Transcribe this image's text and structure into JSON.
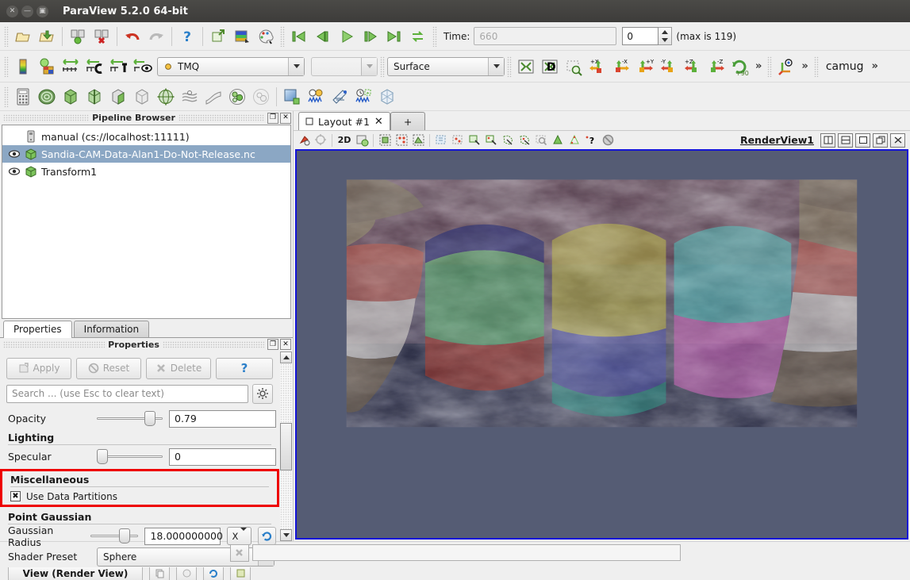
{
  "window": {
    "title": "ParaView 5.2.0 64-bit",
    "controls": [
      "close",
      "minimize",
      "maximize"
    ]
  },
  "main_toolbar": {
    "file_buttons": [
      "open-file-icon",
      "open-recent-icon",
      "connect-server-icon",
      "disconnect-server-icon"
    ],
    "edit_buttons": [
      "undo-icon",
      "redo-icon"
    ],
    "help_button": "help-icon",
    "camera_buttons": [
      "camera-undo-icon",
      "color-map-icon",
      "edit-color-map-icon"
    ]
  },
  "vcr": {
    "buttons": [
      "first-frame",
      "previous-frame",
      "play",
      "next-frame",
      "last-frame",
      "loop"
    ],
    "time_label": "Time:",
    "time_value": "660",
    "frame_value": "0",
    "max_label": "(max is 119)"
  },
  "active_variables": {
    "color_legend_icons": [
      "scalar-bar-icon",
      "rescale-custom-icon",
      "rescale-data-icon",
      "rescale-time-icon",
      "rescale-visible-icon",
      "rescale-visible-eye-icon"
    ],
    "array_name": "TMQ",
    "component": "",
    "representation": "Surface",
    "axis_buttons": [
      "+X",
      "-X",
      "+Y",
      "-Y",
      "+Z",
      "-Z"
    ],
    "rotate_label": "+90",
    "overflow": "»",
    "camera_widget": "camera-orientation-icon",
    "macro_label": "camug"
  },
  "filters_toolbar": {
    "items": [
      "calculator-icon",
      "contour-icon",
      "clip-icon",
      "slice-icon",
      "threshold-icon",
      "extract-subset-icon",
      "glyph-icon",
      "stream-tracer-icon",
      "warp-icon",
      "group-datasets-icon",
      "extract-level-icon",
      "plot-over-line-icon",
      "plot-data-icon",
      "plot-selection-icon",
      "plot-over-time-icon",
      "extract-block-icon"
    ]
  },
  "pipeline_browser": {
    "title": "Pipeline Browser",
    "dock_buttons": [
      "undock-icon",
      "close-icon"
    ],
    "items": [
      {
        "label": "manual (cs://localhost:11111)",
        "icon": "server-icon",
        "selected": false,
        "visible": null,
        "indent": 0
      },
      {
        "label": "Sandia-CAM-Data-Alan1-Do-Not-Release.nc",
        "icon": "dataset-icon",
        "selected": true,
        "visible": true,
        "indent": 0
      },
      {
        "label": "Transform1",
        "icon": "dataset-icon",
        "selected": false,
        "visible": true,
        "indent": 0
      }
    ]
  },
  "properties_panel": {
    "tabs": [
      {
        "label": "Properties",
        "active": true
      },
      {
        "label": "Information",
        "active": false
      }
    ],
    "dock_title": "Properties",
    "dock_buttons": [
      "undock-icon",
      "close-icon"
    ],
    "buttons": [
      {
        "label": "Apply",
        "enabled": false,
        "icon": "apply-icon"
      },
      {
        "label": "Reset",
        "enabled": false,
        "icon": "reset-icon"
      },
      {
        "label": "Delete",
        "enabled": false,
        "icon": "delete-icon"
      },
      {
        "label": "?",
        "enabled": true,
        "icon": "help-icon"
      }
    ],
    "search_placeholder": "Search ... (use Esc to clear text)",
    "gear_icon": "gear-icon",
    "rows": [
      {
        "type": "slider",
        "name": "Opacity",
        "value": "0.79",
        "fraction": 0.79
      },
      {
        "type": "section",
        "name": "Lighting"
      },
      {
        "type": "slider",
        "name": "Specular",
        "value": "0",
        "fraction": 0.02
      },
      {
        "type": "section",
        "name": "Miscellaneous",
        "highlight": true
      },
      {
        "type": "checkbox",
        "name": "Use Data Partitions",
        "checked": true,
        "highlight": true
      },
      {
        "type": "section",
        "name": "Point Gaussian"
      },
      {
        "type": "radius",
        "name": "Gaussian Radius",
        "value": "18.000000000",
        "axis": "X",
        "reset_icon": "reset-range-icon",
        "fraction": 0.62
      },
      {
        "type": "combo",
        "name": "Shader Preset",
        "value": "Sphere"
      }
    ],
    "partial_row_hint": "View (Render View)"
  },
  "layout": {
    "tabs": [
      {
        "label": "Layout #1",
        "closable": true
      },
      {
        "label": "+",
        "closable": false
      }
    ],
    "view_toolbar": [
      "interact-icon",
      "pick-center-icon",
      "2D",
      "reset-camera-icon",
      "select-cells-icon",
      "select-points-icon",
      "select-frustum-cells-icon",
      "select-block-icon",
      "select-points-through-icon",
      "hover-cells-icon",
      "hover-points-icon",
      "select-polygon-cells-icon",
      "select-polygon-points-icon",
      "zoom-box-icon",
      "plot-cells-icon",
      "plot-points-icon",
      "help-view-icon",
      "no-selection-icon"
    ],
    "mode_2d_label": "2D",
    "view_name": "RenderView1",
    "view_buttons": [
      "split-horizontal-icon",
      "split-vertical-icon",
      "maximize-icon",
      "undock-icon",
      "close-icon"
    ]
  },
  "render_view": {
    "background_color": "#555c74",
    "dataset_description": "Global equirectangular climate field (TMQ) with colored data partitions",
    "partition_colors": [
      "#6b4650",
      "#7a6f5a",
      "#b2615b",
      "#cfc9c3",
      "#2b2f6b",
      "#4fa05f",
      "#a33b33",
      "#b5b04a",
      "#4b4f9e",
      "#2f8f80",
      "#45a8a8",
      "#b martial",
      "#c05ca8"
    ]
  },
  "status_bar": {
    "abort_icon": "abort-icon",
    "progress_value": 0,
    "message": ""
  }
}
